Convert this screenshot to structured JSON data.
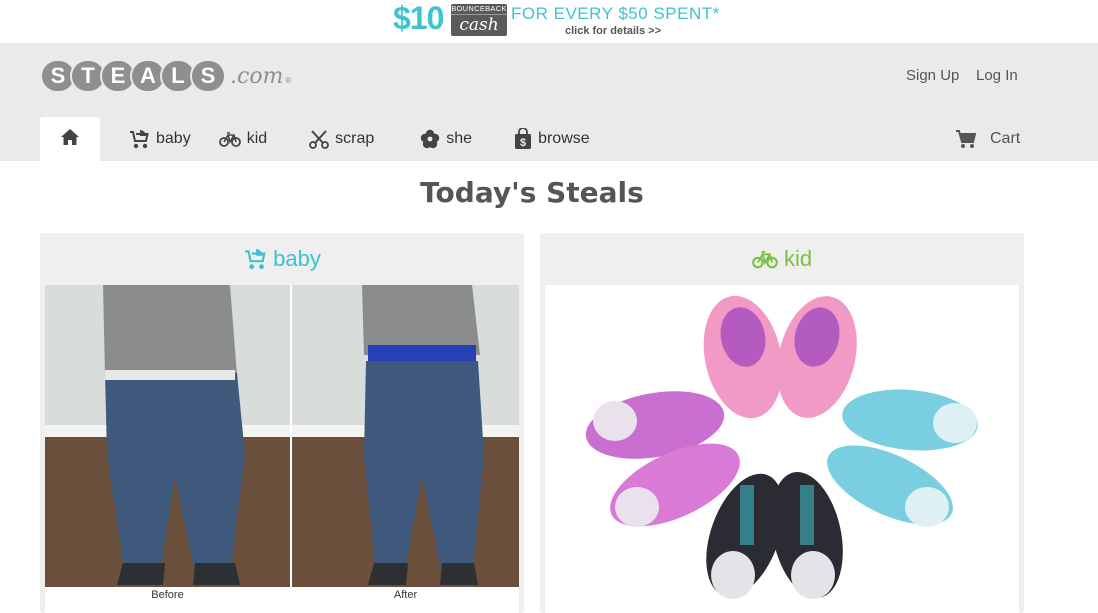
{
  "promo": {
    "amount": "$10",
    "box_top": "BOUNCEBACK",
    "box_bottom": "cash",
    "tagline": "FOR EVERY $50 SPENT*",
    "details": "click for details >>",
    "accent": "#3cc4cf"
  },
  "header": {
    "logo_letters": [
      "S",
      "T",
      "E",
      "A",
      "L",
      "S"
    ],
    "logo_suffix": ".com",
    "logo_reg": "®",
    "signup": "Sign Up",
    "login": "Log In",
    "nav": {
      "home_icon": "home-icon",
      "items": [
        {
          "label": "baby",
          "icon": "stroller-icon"
        },
        {
          "label": "kid",
          "icon": "bicycle-icon"
        },
        {
          "label": "scrap",
          "icon": "scissors-icon"
        },
        {
          "label": "she",
          "icon": "flower-icon"
        },
        {
          "label": "browse",
          "icon": "shopping-bag-icon"
        }
      ]
    },
    "cart": "Cart"
  },
  "main": {
    "title": "Today's Steals",
    "cards": [
      {
        "label": "baby",
        "color": "#3fc0d0",
        "icon": "stroller-icon",
        "captions": [
          "Before",
          "After"
        ]
      },
      {
        "label": "kid",
        "color": "#7cc043",
        "icon": "bicycle-icon"
      }
    ]
  }
}
